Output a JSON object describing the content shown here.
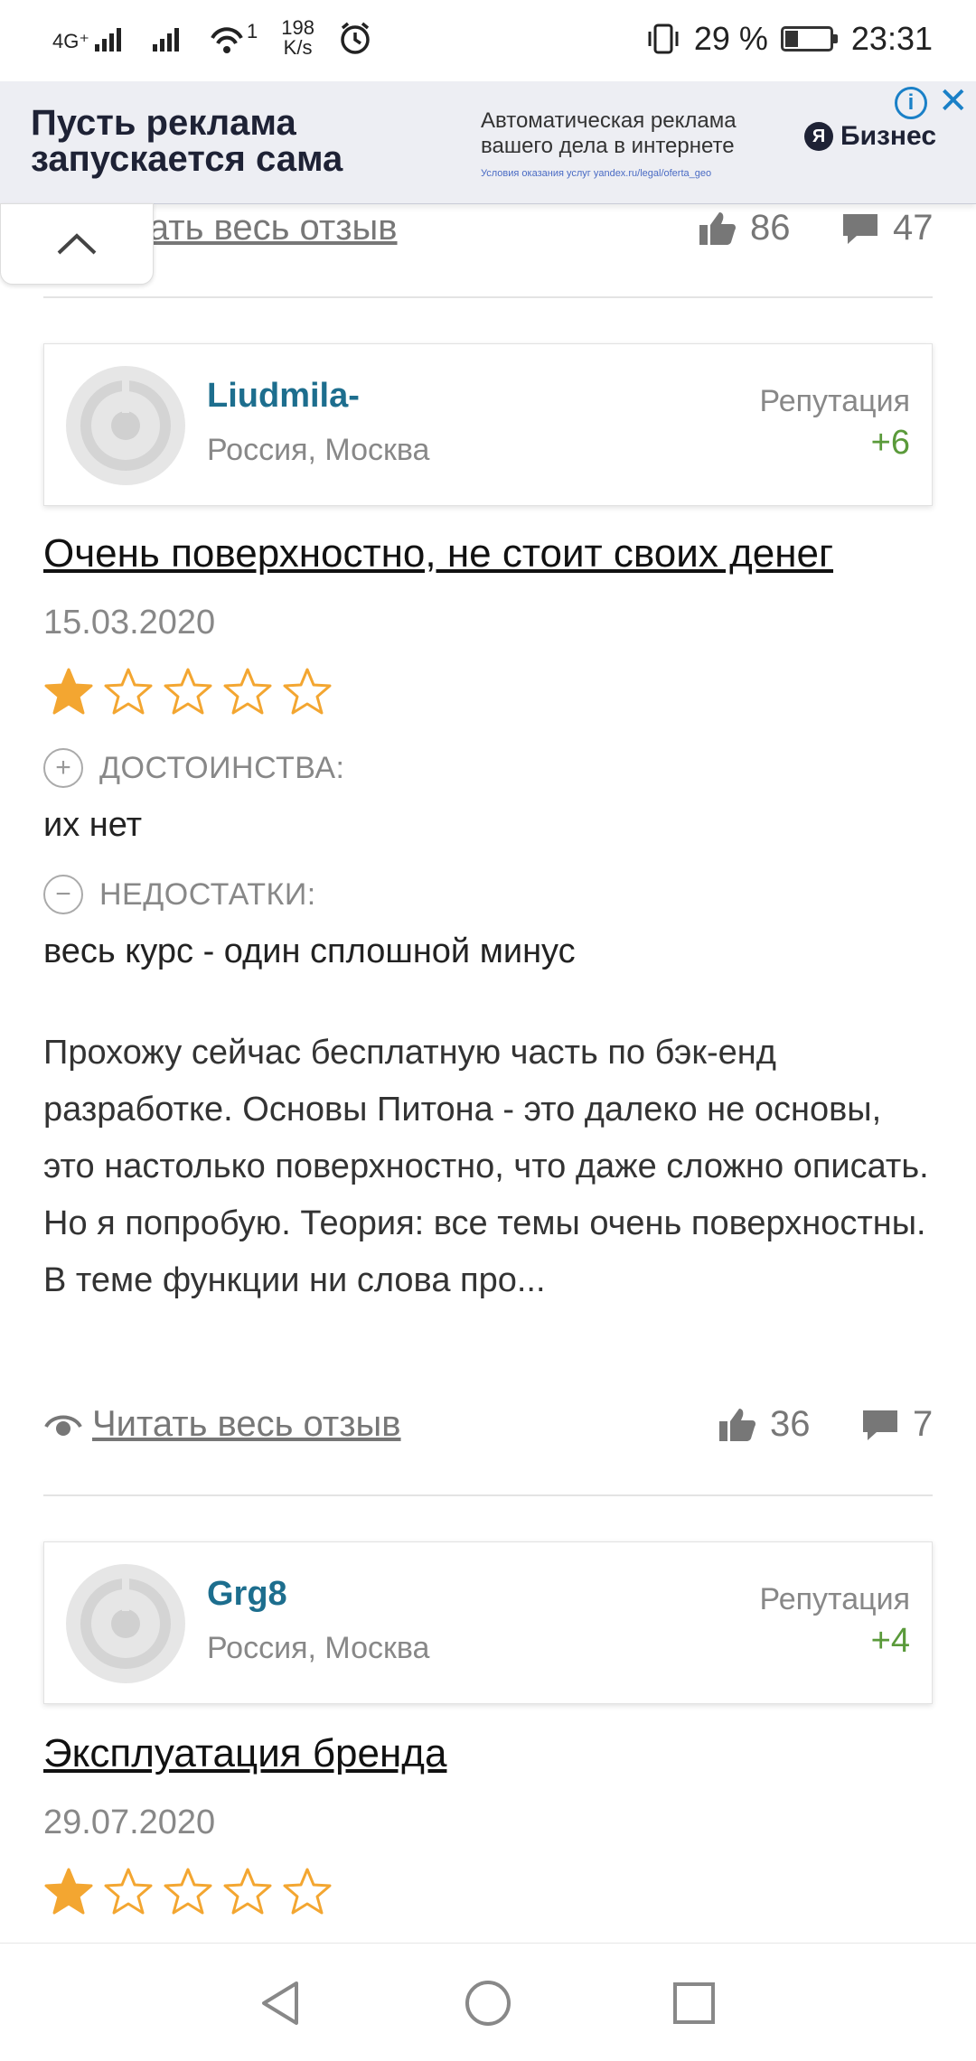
{
  "status_bar": {
    "network": "4G⁺",
    "data_speed": "198",
    "data_speed_unit": "K/s",
    "wifi_badge": "1",
    "battery_percent": "29 %",
    "battery_level": 0.29,
    "time": "23:31"
  },
  "ad": {
    "headline": "Пусть реклама\nзапускается сама",
    "subtext": "Автоматическая реклама\nвашего дела в интернете",
    "fine_print": "Условия оказания услуг yandex.ru/legal/oferta_geo",
    "brand_logo": "Я",
    "brand": "Бизнес"
  },
  "prev_review": {
    "read_more": "Читать весь отзыв",
    "likes": "86",
    "comments": "47"
  },
  "reviews": [
    {
      "username": "Liudmila-",
      "location": "Россия, Москва",
      "reputation_label": "Репутация",
      "reputation": "+6",
      "title": "Очень поверхностно, не стоит своих денег",
      "date": "15.03.2020",
      "rating": 1,
      "pros_label": "ДОСТОИНСТВА:",
      "pros": "их нет",
      "cons_label": "НЕДОСТАТКИ:",
      "cons": "весь курс - один сплошной минус",
      "body": "Прохожу сейчас бесплатную часть по бэк-енд разработке. Основы Питона - это далеко не основы, это настолько поверхностно, что даже сложно описать. Но я попробую. Теория: все темы очень поверхностны. В теме функции ни слова про...",
      "read_more": "Читать весь отзыв",
      "likes": "36",
      "comments": "7"
    },
    {
      "username": "Grg8",
      "location": "Россия, Москва",
      "reputation_label": "Репутация",
      "reputation": "+4",
      "title": "Эксплуатация бренда",
      "date": "29.07.2020",
      "rating": 1
    }
  ],
  "colors": {
    "username": "#1d6e8e",
    "reputation": "#5a9a3a",
    "star": "#f3a631",
    "ad_bg": "#edeef3"
  },
  "icons": [
    "thumbs-up-icon",
    "comment-icon",
    "eye-icon",
    "chevron-up-icon",
    "star-icon",
    "plus-circle-icon",
    "minus-circle-icon",
    "back-icon",
    "home-icon",
    "recents-icon"
  ]
}
